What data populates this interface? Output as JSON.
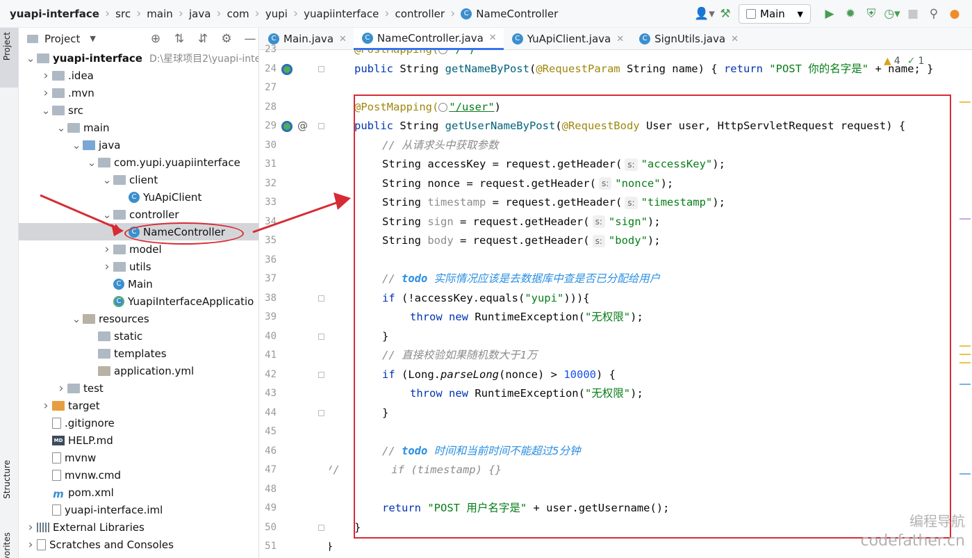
{
  "breadcrumb": [
    "yuapi-interface",
    "src",
    "main",
    "java",
    "com",
    "yupi",
    "yuapiinterface",
    "controller",
    "NameController"
  ],
  "toolbar": {
    "run_config": "Main",
    "user_icon": "user-icon",
    "build_icon": "hammer-icon",
    "run_icon": "run-icon",
    "debug_icon": "bug-icon",
    "search_icon": "search-icon"
  },
  "side_strip": {
    "project": "Project",
    "structure": "Structure",
    "favorites": "Favorites"
  },
  "project_panel": {
    "title": "Project"
  },
  "tree": [
    {
      "label": "yuapi-interface",
      "extra": "D:\\星球项目2\\yuapi-inte",
      "depth": 0,
      "arrow": "down",
      "icon": "module",
      "bold": true
    },
    {
      "label": ".idea",
      "depth": 1,
      "arrow": "right",
      "icon": "folder"
    },
    {
      "label": ".mvn",
      "depth": 1,
      "arrow": "right",
      "icon": "folder"
    },
    {
      "label": "src",
      "depth": 1,
      "arrow": "down",
      "icon": "folder"
    },
    {
      "label": "main",
      "depth": 2,
      "arrow": "down",
      "icon": "folder"
    },
    {
      "label": "java",
      "depth": 3,
      "arrow": "down",
      "icon": "folder-blue"
    },
    {
      "label": "com.yupi.yuapiinterface",
      "depth": 4,
      "arrow": "down",
      "icon": "package"
    },
    {
      "label": "client",
      "depth": 5,
      "arrow": "down",
      "icon": "package"
    },
    {
      "label": "YuApiClient",
      "depth": 6,
      "arrow": "none",
      "icon": "class"
    },
    {
      "label": "controller",
      "depth": 5,
      "arrow": "down",
      "icon": "package"
    },
    {
      "label": "NameController",
      "depth": 6,
      "arrow": "none",
      "icon": "class",
      "selected": true
    },
    {
      "label": "model",
      "depth": 5,
      "arrow": "right",
      "icon": "package"
    },
    {
      "label": "utils",
      "depth": 5,
      "arrow": "right",
      "icon": "package"
    },
    {
      "label": "Main",
      "depth": 5,
      "arrow": "none",
      "icon": "class"
    },
    {
      "label": "YuapiInterfaceApplicatio",
      "depth": 5,
      "arrow": "none",
      "icon": "app-class"
    },
    {
      "label": "resources",
      "depth": 3,
      "arrow": "down",
      "icon": "resources"
    },
    {
      "label": "static",
      "depth": 4,
      "arrow": "none",
      "icon": "folder"
    },
    {
      "label": "templates",
      "depth": 4,
      "arrow": "none",
      "icon": "folder"
    },
    {
      "label": "application.yml",
      "depth": 4,
      "arrow": "none",
      "icon": "yml"
    },
    {
      "label": "test",
      "depth": 2,
      "arrow": "right",
      "icon": "folder"
    },
    {
      "label": "target",
      "depth": 1,
      "arrow": "right",
      "icon": "folder-orange"
    },
    {
      "label": ".gitignore",
      "depth": 1,
      "arrow": "none",
      "icon": "file"
    },
    {
      "label": "HELP.md",
      "depth": 1,
      "arrow": "none",
      "icon": "md"
    },
    {
      "label": "mvnw",
      "depth": 1,
      "arrow": "none",
      "icon": "script"
    },
    {
      "label": "mvnw.cmd",
      "depth": 1,
      "arrow": "none",
      "icon": "file"
    },
    {
      "label": "pom.xml",
      "depth": 1,
      "arrow": "none",
      "icon": "maven"
    },
    {
      "label": "yuapi-interface.iml",
      "depth": 1,
      "arrow": "none",
      "icon": "file"
    },
    {
      "label": "External Libraries",
      "depth": 0,
      "arrow": "right",
      "icon": "libs"
    },
    {
      "label": "Scratches and Consoles",
      "depth": 0,
      "arrow": "right",
      "icon": "scratch"
    }
  ],
  "tabs": [
    {
      "label": "Main.java",
      "active": false
    },
    {
      "label": "NameController.java",
      "active": true
    },
    {
      "label": "YuApiClient.java",
      "active": false
    },
    {
      "label": "SignUtils.java",
      "active": false
    }
  ],
  "inspections": {
    "warnings": "4",
    "ok": "1"
  },
  "gutter": [
    {
      "n": "23"
    },
    {
      "n": "24",
      "run": true,
      "fold": true
    },
    {
      "n": "27"
    },
    {
      "n": "28"
    },
    {
      "n": "29",
      "run": true,
      "at": true,
      "fold": true
    },
    {
      "n": "30"
    },
    {
      "n": "31"
    },
    {
      "n": "32"
    },
    {
      "n": "33"
    },
    {
      "n": "34"
    },
    {
      "n": "35"
    },
    {
      "n": "36"
    },
    {
      "n": "37"
    },
    {
      "n": "38",
      "fold": true
    },
    {
      "n": "39"
    },
    {
      "n": "40",
      "fold": true
    },
    {
      "n": "41"
    },
    {
      "n": "42",
      "fold": true
    },
    {
      "n": "43"
    },
    {
      "n": "44",
      "fold": true
    },
    {
      "n": "45"
    },
    {
      "n": "46"
    },
    {
      "n": "47"
    },
    {
      "n": "48"
    },
    {
      "n": "49"
    },
    {
      "n": "50",
      "fold": true
    },
    {
      "n": "51"
    }
  ],
  "code": [
    {
      "indent": 36,
      "parts": [
        [
          "ann",
          "@PostMapping("
        ],
        [
          "globe",
          ""
        ],
        [
          "str",
          "\"/\")"
        ]
      ]
    },
    {
      "indent": 36,
      "parts": [
        [
          "kw",
          "public "
        ],
        [
          "txt",
          "String "
        ],
        [
          "mth",
          "getNameByPost"
        ],
        [
          "txt",
          "("
        ],
        [
          "ann",
          "@RequestParam "
        ],
        [
          "txt",
          "String name) { "
        ],
        [
          "kw",
          "return "
        ],
        [
          "str",
          "\"POST 你的名字是\" "
        ],
        [
          "txt",
          "+ name; }"
        ]
      ]
    },
    {
      "indent": 36,
      "parts": []
    },
    {
      "indent": 36,
      "parts": [
        [
          "ann",
          "@PostMapping("
        ],
        [
          "globe",
          ""
        ],
        [
          "url",
          "\"/user\""
        ],
        [
          "txt",
          ")"
        ]
      ]
    },
    {
      "indent": 36,
      "parts": [
        [
          "kw",
          "public "
        ],
        [
          "txt",
          "String "
        ],
        [
          "mth",
          "getUserNameByPost"
        ],
        [
          "txt",
          "("
        ],
        [
          "ann",
          "@RequestBody "
        ],
        [
          "txt",
          "User user, HttpServletRequest request) {"
        ]
      ]
    },
    {
      "indent": 76,
      "parts": [
        [
          "cmt",
          "// 从请求头中获取参数"
        ]
      ]
    },
    {
      "indent": 76,
      "parts": [
        [
          "txt",
          "String accessKey = request.getHeader("
        ],
        [
          "hint",
          "s:"
        ],
        [
          "str",
          "\"accessKey\""
        ],
        [
          "txt",
          ");"
        ]
      ]
    },
    {
      "indent": 76,
      "parts": [
        [
          "txt",
          "String nonce = request.getHeader("
        ],
        [
          "hint",
          "s:"
        ],
        [
          "str",
          "\"nonce\""
        ],
        [
          "txt",
          ");"
        ]
      ]
    },
    {
      "indent": 76,
      "parts": [
        [
          "txt",
          "String "
        ],
        [
          "cmtp",
          "timestamp"
        ],
        [
          "txt",
          " = request.getHeader("
        ],
        [
          "hint",
          "s:"
        ],
        [
          "str",
          "\"timestamp\""
        ],
        [
          "txt",
          ");"
        ]
      ]
    },
    {
      "indent": 76,
      "parts": [
        [
          "txt",
          "String "
        ],
        [
          "cmtp",
          "sign"
        ],
        [
          "txt",
          " = request.getHeader("
        ],
        [
          "hint",
          "s:"
        ],
        [
          "str",
          "\"sign\""
        ],
        [
          "txt",
          ");"
        ]
      ]
    },
    {
      "indent": 76,
      "parts": [
        [
          "txt",
          "String "
        ],
        [
          "cmtp",
          "body"
        ],
        [
          "txt",
          " = request.getHeader("
        ],
        [
          "hint",
          "s:"
        ],
        [
          "str",
          "\"body\""
        ],
        [
          "txt",
          ");"
        ]
      ]
    },
    {
      "indent": 76,
      "parts": []
    },
    {
      "indent": 76,
      "parts": [
        [
          "cmt",
          "// "
        ],
        [
          "todob",
          "todo"
        ],
        [
          "todo",
          " 实际情况应该是去数据库中查是否已分配给用户"
        ]
      ]
    },
    {
      "indent": 76,
      "parts": [
        [
          "kw",
          "if "
        ],
        [
          "txt",
          "(!accessKey.equals("
        ],
        [
          "str",
          "\"yupi\""
        ],
        [
          "txt",
          "))){"
        ]
      ]
    },
    {
      "indent": 116,
      "parts": [
        [
          "kw",
          "throw new "
        ],
        [
          "txt",
          "RuntimeException("
        ],
        [
          "str",
          "\"无权限\""
        ],
        [
          "txt",
          ");"
        ]
      ]
    },
    {
      "indent": 76,
      "parts": [
        [
          "txt",
          "}"
        ]
      ]
    },
    {
      "indent": 76,
      "parts": [
        [
          "cmt",
          "// 直接校验如果随机数大于1万"
        ]
      ]
    },
    {
      "indent": 76,
      "parts": [
        [
          "kw",
          "if "
        ],
        [
          "txt",
          "(Long."
        ],
        [
          "ital",
          "parseLong"
        ],
        [
          "txt",
          "(nonce) > "
        ],
        [
          "num",
          "10000"
        ],
        [
          "txt",
          ") {"
        ]
      ]
    },
    {
      "indent": 116,
      "parts": [
        [
          "kw",
          "throw new "
        ],
        [
          "txt",
          "RuntimeException("
        ],
        [
          "str",
          "\"无权限\""
        ],
        [
          "txt",
          ");"
        ]
      ]
    },
    {
      "indent": 76,
      "parts": [
        [
          "txt",
          "}"
        ]
      ]
    },
    {
      "indent": 76,
      "parts": []
    },
    {
      "indent": 76,
      "parts": [
        [
          "cmt",
          "// "
        ],
        [
          "todob",
          "todo"
        ],
        [
          "todo",
          " 时间和当前时间不能超过5分钟"
        ]
      ]
    },
    {
      "indent": -4,
      "parts": [
        [
          "cmt",
          "//        if (timestamp) {}"
        ]
      ]
    },
    {
      "indent": 76,
      "parts": []
    },
    {
      "indent": 76,
      "parts": [
        [
          "kw",
          "return "
        ],
        [
          "str",
          "\"POST 用户名字是\" "
        ],
        [
          "txt",
          "+ user.getUsername();"
        ]
      ]
    },
    {
      "indent": 36,
      "parts": [
        [
          "txt",
          "}"
        ]
      ]
    },
    {
      "indent": -4,
      "parts": [
        [
          "txt",
          "}"
        ]
      ]
    }
  ],
  "watermark": {
    "line1": "编程导航",
    "line2": "codefather.cn"
  },
  "colors": {
    "annotation_red": "#d62b34",
    "accent": "#3574f0"
  }
}
